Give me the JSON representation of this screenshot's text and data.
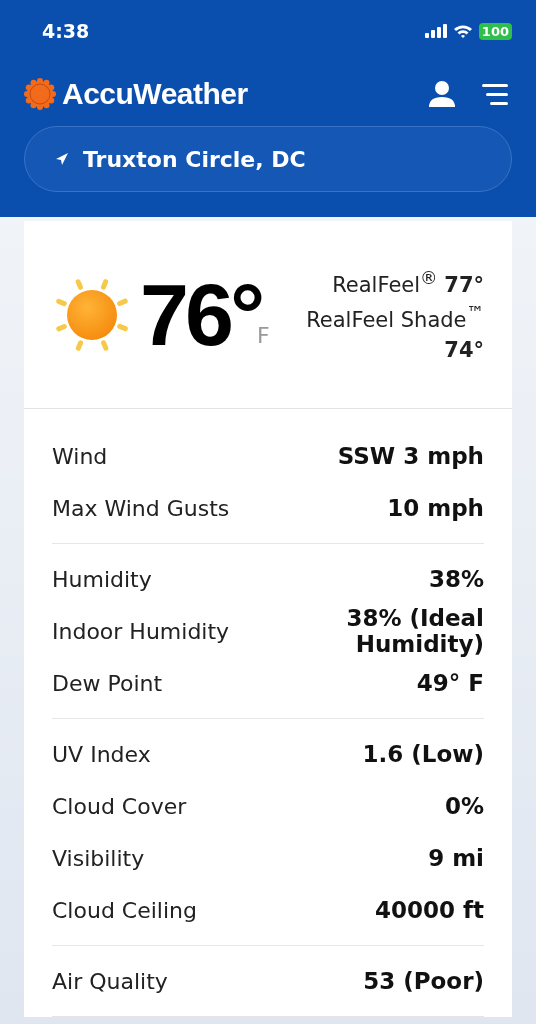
{
  "status_bar": {
    "time": "4:38",
    "battery": "100"
  },
  "header": {
    "brand": "AccuWeather",
    "location": "Truxton Circle, DC"
  },
  "current": {
    "temperature": "76°",
    "unit": "F",
    "realfeel_label": "RealFeel$^{®}$",
    "realfeel_value": "77°",
    "shade_label": "RealFeel Shade$^{™}$",
    "shade_value": "74°"
  },
  "groups": [
    [
      {
        "label": "Wind",
        "value": "SSW 3 mph"
      },
      {
        "label": "Max Wind Gusts",
        "value": "10 mph"
      }
    ],
    [
      {
        "label": "Humidity",
        "value": "38%"
      },
      {
        "label": "Indoor Humidity",
        "value": "38% (Ideal Humidity)"
      },
      {
        "label": "Dew Point",
        "value": "49° F"
      }
    ],
    [
      {
        "label": "UV Index",
        "value": "1.6 (Low)"
      },
      {
        "label": "Cloud Cover",
        "value": "0%"
      },
      {
        "label": "Visibility",
        "value": "9 mi"
      },
      {
        "label": "Cloud Ceiling",
        "value": "40000 ft"
      }
    ],
    [
      {
        "label": "Air Quality",
        "value": "53 (Poor)"
      }
    ]
  ]
}
